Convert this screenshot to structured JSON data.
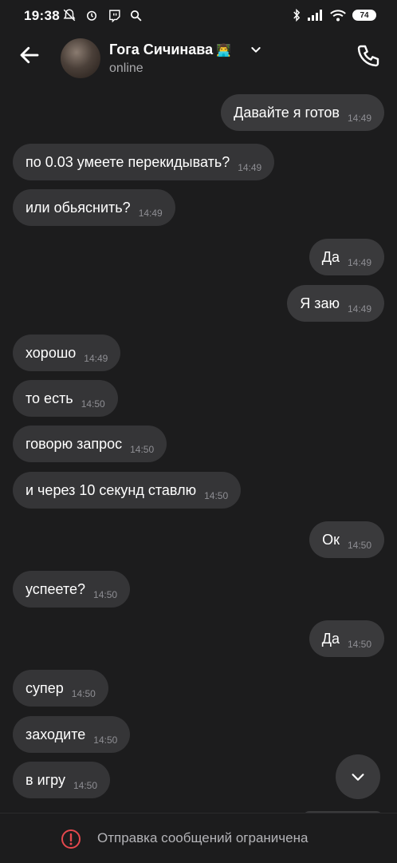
{
  "status_bar": {
    "time": "19:38",
    "battery": "74",
    "icons": [
      "notifications-off-icon",
      "alarm-icon",
      "twitch-icon",
      "search-icon",
      "bluetooth-icon",
      "signal-icon",
      "wifi-icon",
      "battery-icon"
    ]
  },
  "header": {
    "contact_name": "Гога Сичинава",
    "contact_emoji": "👨‍💻",
    "status": "online"
  },
  "messages": [
    {
      "dir": "out",
      "text": "Давайте я готов",
      "time": "14:49"
    },
    {
      "dir": "in",
      "text": "по 0.03 умеете перекидывать?",
      "time": "14:49"
    },
    {
      "dir": "in",
      "text": "или обьяснить?",
      "time": "14:49"
    },
    {
      "dir": "out",
      "text": "Да",
      "time": "14:49"
    },
    {
      "dir": "out",
      "text": "Я заю",
      "time": "14:49"
    },
    {
      "dir": "in",
      "text": "хорошо",
      "time": "14:49"
    },
    {
      "dir": "in",
      "text": "то есть",
      "time": "14:50"
    },
    {
      "dir": "in",
      "text": "говорю запрос",
      "time": "14:50"
    },
    {
      "dir": "in",
      "text": "и через 10 секунд ставлю",
      "time": "14:50"
    },
    {
      "dir": "out",
      "text": "Ок",
      "time": "14:50"
    },
    {
      "dir": "in",
      "text": "успеете?",
      "time": "14:50"
    },
    {
      "dir": "out",
      "text": "Да",
      "time": "14:50"
    },
    {
      "dir": "in",
      "text": "супер",
      "time": "14:50"
    },
    {
      "dir": "in",
      "text": "заходите",
      "time": "14:50"
    },
    {
      "dir": "in",
      "text": "в игру",
      "time": "14:50"
    }
  ],
  "footer": {
    "restriction_text": "Отправка сообщений ограничена"
  },
  "colors": {
    "background": "#1c1c1d",
    "bubble": "#353537",
    "timestamp": "#8e8e93",
    "warning": "#e5484d"
  }
}
